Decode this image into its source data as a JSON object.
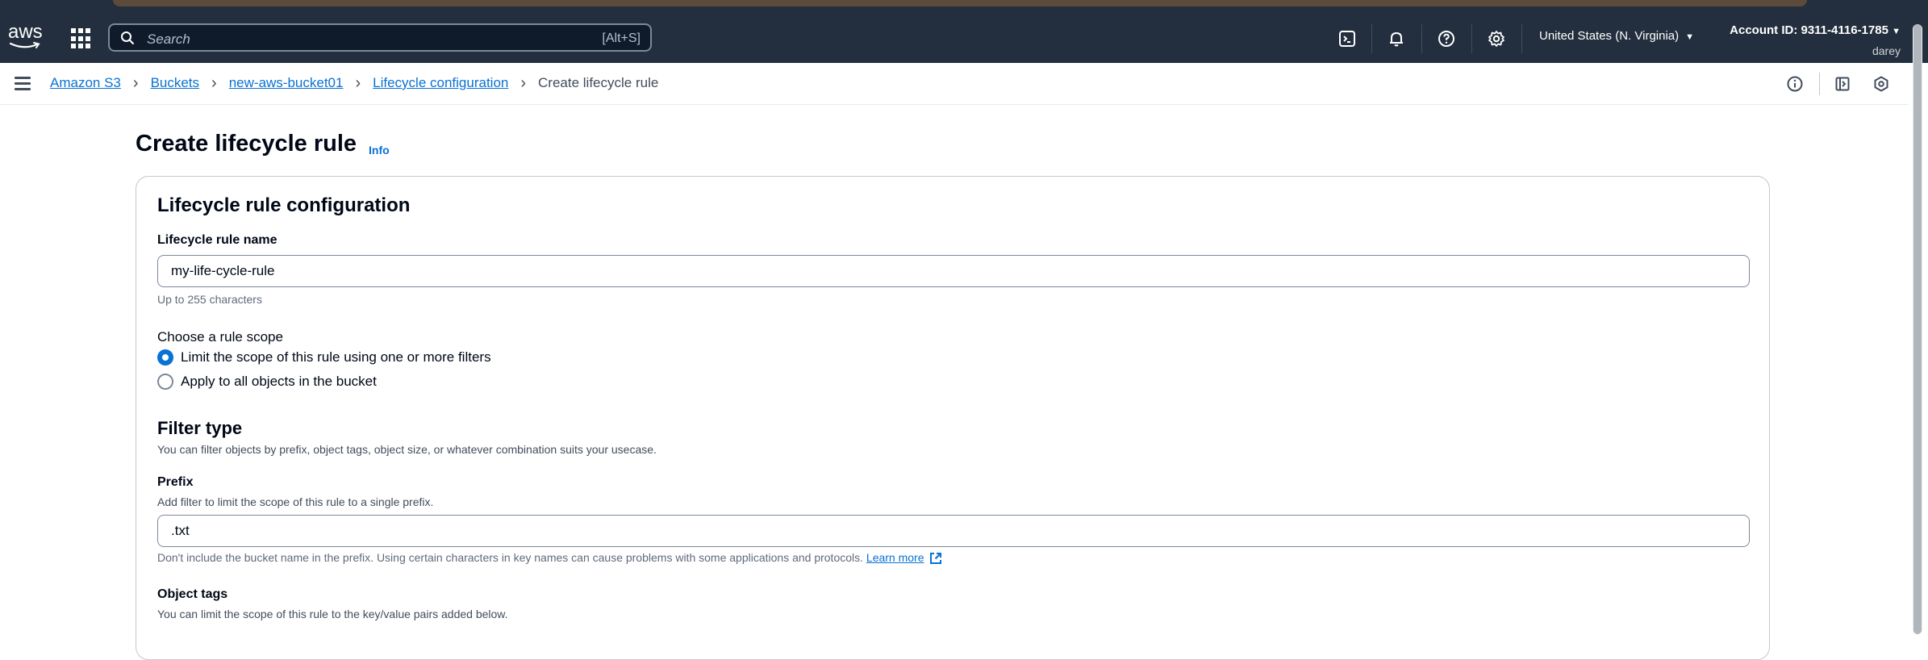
{
  "topnav": {
    "logo_text": "aws",
    "search": {
      "placeholder": "Search",
      "shortcut": "[Alt+S]"
    },
    "icons": [
      "cloudshell-icon",
      "bell-icon",
      "help-icon",
      "gear-icon"
    ],
    "region": "United States (N. Virginia)",
    "account": "Account ID: 9311-4116-1785",
    "user": "darey"
  },
  "breadcrumb": {
    "items": [
      "Amazon S3",
      "Buckets",
      "new-aws-bucket01",
      "Lifecycle configuration"
    ],
    "current": "Create lifecycle rule"
  },
  "page": {
    "title": "Create lifecycle rule",
    "info": "Info"
  },
  "config": {
    "title": "Lifecycle rule configuration",
    "rule_name": {
      "label": "Lifecycle rule name",
      "value": "my-life-cycle-rule",
      "hint": "Up to 255 characters"
    },
    "scope": {
      "label": "Choose a rule scope",
      "options": [
        {
          "label": "Limit the scope of this rule using one or more filters",
          "checked": true
        },
        {
          "label": "Apply to all objects in the bucket",
          "checked": false
        }
      ]
    },
    "filter": {
      "title": "Filter type",
      "desc": "You can filter objects by prefix, object tags, object size, or whatever combination suits your usecase."
    },
    "prefix": {
      "label": "Prefix",
      "desc": "Add filter to limit the scope of this rule to a single prefix.",
      "value": ".txt",
      "hint": "Don't include the bucket name in the prefix. Using certain characters in key names can cause problems with some applications and protocols.",
      "learn_more": "Learn more"
    },
    "tags": {
      "label": "Object tags",
      "desc": "You can limit the scope of this rule to the key/value pairs added below."
    }
  },
  "colors": {
    "nav_bg": "#232f3e",
    "link": "#0972d3",
    "text": "#000716",
    "border": "#7d8998"
  }
}
